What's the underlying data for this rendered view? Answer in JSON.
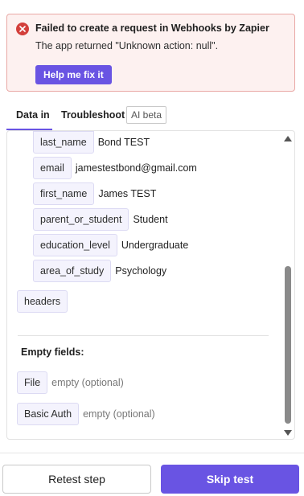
{
  "error": {
    "title": "Failed to create a request in Webhooks by Zapier",
    "message": "The app returned \"Unknown action: null\".",
    "help_button": "Help me fix it",
    "accent_color": "#d33f3b",
    "icon": "error-x-circle-icon"
  },
  "tabs": [
    {
      "label": "Data in",
      "active": true
    },
    {
      "label": "Troubleshoot",
      "active": false
    }
  ],
  "ai_badge": "AI beta",
  "fields": [
    {
      "key": "last_name",
      "value": "Bond TEST"
    },
    {
      "key": "email",
      "value": "jamestestbond@gmail.com"
    },
    {
      "key": "first_name",
      "value": "James TEST"
    },
    {
      "key": "parent_or_student",
      "value": "Student"
    },
    {
      "key": "education_level",
      "value": "Undergraduate"
    },
    {
      "key": "area_of_study",
      "value": "Psychology"
    }
  ],
  "headers_label": "headers",
  "empty_section": {
    "title": "Empty fields:",
    "items": [
      {
        "key": "File",
        "value": "empty (optional)"
      },
      {
        "key": "Basic Auth",
        "value": "empty (optional)"
      }
    ]
  },
  "footer": {
    "retest_label": "Retest step",
    "skip_label": "Skip test"
  },
  "colors": {
    "brand": "#6954e3",
    "error_bg": "#fdf1f0",
    "key_bg": "#f4f3fd"
  }
}
